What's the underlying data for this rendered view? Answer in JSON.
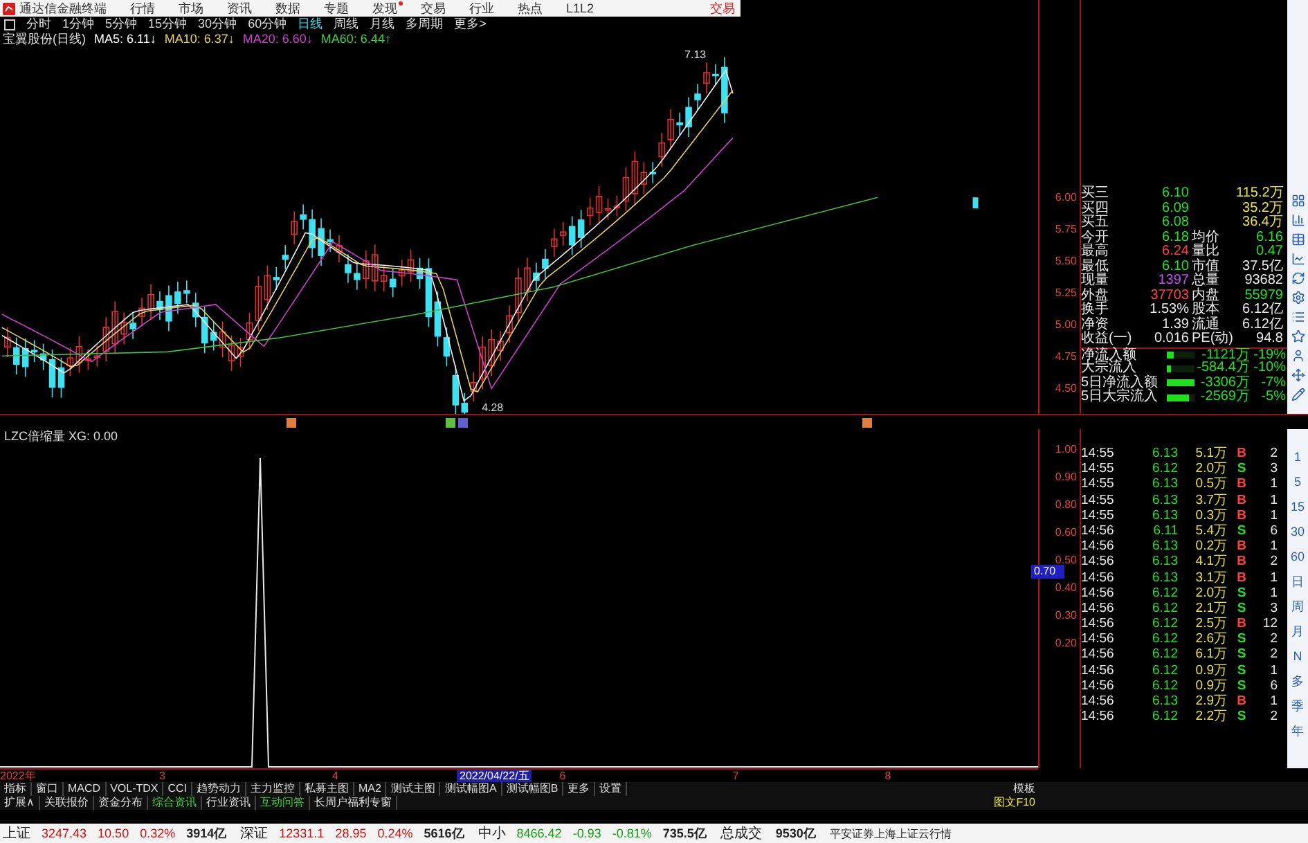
{
  "menu_bar": {
    "app_title": "通达信金融终端",
    "items": [
      "行情",
      "市场",
      "资讯",
      "数据",
      "专题",
      "发现",
      "交易",
      "行业",
      "热点",
      "L1L2"
    ],
    "trade": "交易"
  },
  "period_tabs": [
    {
      "label": "分时",
      "selected": false
    },
    {
      "label": "1分钟",
      "selected": false
    },
    {
      "label": "5分钟",
      "selected": false
    },
    {
      "label": "15分钟",
      "selected": false
    },
    {
      "label": "30分钟",
      "selected": false
    },
    {
      "label": "60分钟",
      "selected": false
    },
    {
      "label": "日线",
      "selected": true
    },
    {
      "label": "周线",
      "selected": false
    },
    {
      "label": "月线",
      "selected": false
    },
    {
      "label": "多周期",
      "selected": false
    },
    {
      "label": "更多>",
      "selected": false
    }
  ],
  "ma_legend": {
    "stock": "宝翼股份(日线)",
    "items": [
      {
        "label": "MA5: 6.11",
        "arrow": "↓",
        "color": "#ffffff"
      },
      {
        "label": "MA10: 6.37",
        "arrow": "↓",
        "color": "#e8d060"
      },
      {
        "label": "MA20: 6.60",
        "arrow": "↓",
        "color": "#d040d0"
      },
      {
        "label": "MA60: 6.44",
        "arrow": "↑",
        "color": "#40d040"
      }
    ]
  },
  "price_chart": {
    "high_label": "7.13",
    "low_label": "4.28"
  },
  "price_axis": [
    "6.00",
    "5.75",
    "5.50",
    "5.25",
    "5.00",
    "4.75",
    "4.50"
  ],
  "quote": {
    "rows": [
      {
        "left": {
          "label": "买三",
          "value": "6.10",
          "color": "#20e020"
        },
        "right": {
          "value": "115.2万",
          "color": "#e8e040"
        }
      },
      {
        "left": {
          "label": "买四",
          "value": "6.09",
          "color": "#20e020"
        },
        "right": {
          "value": "35.2万",
          "color": "#e8e040"
        }
      },
      {
        "left": {
          "label": "买五",
          "value": "6.08",
          "color": "#20e020"
        },
        "right": {
          "value": "36.4万",
          "color": "#e8e040"
        }
      },
      {
        "left": {
          "label": "今开",
          "value": "6.18",
          "color": "#20e020"
        },
        "right": {
          "label": "均价",
          "value": "6.16",
          "color": "#20e020"
        }
      },
      {
        "left": {
          "label": "最高",
          "value": "6.24",
          "color": "#ff4040"
        },
        "right": {
          "label": "量比",
          "value": "0.47",
          "color": "#20e020"
        }
      },
      {
        "left": {
          "label": "最低",
          "value": "6.10",
          "color": "#20e020"
        },
        "right": {
          "label": "市值",
          "value": "37.5亿",
          "color": "#e8e8e8"
        }
      },
      {
        "left": {
          "label": "现量",
          "value": "1397",
          "color": "#c050f0"
        },
        "right": {
          "label": "总量",
          "value": "93682",
          "color": "#e8e8e8"
        }
      },
      {
        "left": {
          "label": "外盘",
          "value": "37703",
          "color": "#ff4040"
        },
        "right": {
          "label": "内盘",
          "value": "55979",
          "color": "#20e020"
        }
      },
      {
        "left": {
          "label": "换手",
          "value": "1.53%",
          "color": "#e8e8e8"
        },
        "right": {
          "label": "股本",
          "value": "6.12亿",
          "color": "#e8e8e8"
        }
      },
      {
        "left": {
          "label": "净资",
          "value": "1.39",
          "color": "#e8e8e8"
        },
        "right": {
          "label": "流通",
          "value": "6.12亿",
          "color": "#e8e8e8"
        }
      },
      {
        "left": {
          "label": "收益(一)",
          "value": "0.016",
          "color": "#e8e8e8"
        },
        "right": {
          "label": "PE(动)",
          "value": "94.8",
          "color": "#e8e8e8"
        }
      }
    ]
  },
  "fund_flows": [
    {
      "label": "净流入额",
      "level": 0.25,
      "amount": "-1121万",
      "pct": "-19%"
    },
    {
      "label": "大宗流入",
      "level": 0.15,
      "amount": "-584.4万",
      "pct": "-10%"
    },
    {
      "label": "5日净流入额",
      "level": 1,
      "amount": "-3306万",
      "pct": "-7%"
    },
    {
      "label": "5日大宗流入",
      "level": 0.8,
      "amount": "-2569万",
      "pct": "-5%"
    }
  ],
  "indicator": {
    "legend": "LZC倍缩量 XG: 0.00",
    "ticks": [
      "1.00",
      "0.90",
      "0.80",
      "0.60",
      "0.50",
      "0.40",
      "0.30",
      "0.20"
    ],
    "cursor_value": "0.70"
  },
  "trades": [
    {
      "time": "14:55",
      "price": "6.13",
      "volume": "5.1万",
      "side": "B",
      "buy": true,
      "count": "2"
    },
    {
      "time": "14:55",
      "price": "6.12",
      "volume": "2.0万",
      "side": "S",
      "buy": false,
      "count": "3"
    },
    {
      "time": "14:55",
      "price": "6.13",
      "volume": "0.5万",
      "side": "B",
      "buy": true,
      "count": "1"
    },
    {
      "time": "14:55",
      "price": "6.13",
      "volume": "3.7万",
      "side": "B",
      "buy": true,
      "count": "1"
    },
    {
      "time": "14:55",
      "price": "6.13",
      "volume": "0.3万",
      "side": "B",
      "buy": true,
      "count": "1"
    },
    {
      "time": "14:56",
      "price": "6.11",
      "volume": "5.4万",
      "side": "S",
      "buy": false,
      "count": "6"
    },
    {
      "time": "14:56",
      "price": "6.13",
      "volume": "0.2万",
      "side": "B",
      "buy": true,
      "count": "1"
    },
    {
      "time": "14:56",
      "price": "6.13",
      "volume": "4.1万",
      "side": "B",
      "buy": true,
      "count": "2"
    },
    {
      "time": "14:56",
      "price": "6.13",
      "volume": "3.1万",
      "side": "B",
      "buy": true,
      "count": "1"
    },
    {
      "time": "14:56",
      "price": "6.12",
      "volume": "2.0万",
      "side": "S",
      "buy": false,
      "count": "1"
    },
    {
      "time": "14:56",
      "price": "6.12",
      "volume": "2.1万",
      "side": "S",
      "buy": false,
      "count": "3"
    },
    {
      "time": "14:56",
      "price": "6.12",
      "volume": "2.5万",
      "side": "B",
      "buy": true,
      "count": "12"
    },
    {
      "time": "14:56",
      "price": "6.12",
      "volume": "2.6万",
      "side": "S",
      "buy": false,
      "count": "2"
    },
    {
      "time": "14:56",
      "price": "6.12",
      "volume": "6.1万",
      "side": "S",
      "buy": false,
      "count": "2"
    },
    {
      "time": "14:56",
      "price": "6.12",
      "volume": "0.9万",
      "side": "S",
      "buy": false,
      "count": "1"
    },
    {
      "time": "14:56",
      "price": "6.12",
      "volume": "0.9万",
      "side": "S",
      "buy": false,
      "count": "6"
    },
    {
      "time": "14:56",
      "price": "6.13",
      "volume": "2.9万",
      "side": "B",
      "buy": true,
      "count": "1"
    },
    {
      "time": "14:56",
      "price": "6.12",
      "volume": "2.2万",
      "side": "S",
      "buy": false,
      "count": "2"
    }
  ],
  "side_periods": [
    "1",
    "5",
    "15",
    "30",
    "60",
    "日",
    "周",
    "月",
    "N",
    "多",
    "季",
    "年"
  ],
  "date_axis": {
    "labels": [
      "2022年",
      "3",
      "4",
      "6",
      "7",
      "8"
    ],
    "cursor_date": "2022/04/22/五"
  },
  "indicator_tabs": [
    "指标",
    "窗口",
    "MACD",
    "VOL-TDX",
    "CCI",
    "趋势动力",
    "主力监控",
    "私募主图",
    "MA2",
    "测试主图",
    "测试幅图A",
    "测试幅图B",
    "更多",
    "设置"
  ],
  "template": "模板",
  "extension_tabs": [
    {
      "label": "扩展∧",
      "selected": false
    },
    {
      "label": "关联报价",
      "selected": false
    },
    {
      "label": "资金分布",
      "selected": false
    },
    {
      "label": "综合资讯",
      "selected": true
    },
    {
      "label": "行业资讯",
      "selected": false
    },
    {
      "label": "互动问答",
      "selected": true
    },
    {
      "label": "长周户福利专窗",
      "selected": false
    }
  ],
  "f10": "图文F10",
  "status_bar": {
    "indices": [
      {
        "name": "上证",
        "value": "3247.43",
        "change": "10.50",
        "pct": "0.32%",
        "amount": "3914亿",
        "color": "#d01010"
      },
      {
        "name": "深证",
        "value": "12331.1",
        "change": "28.95",
        "pct": "0.24%",
        "amount": "5616亿",
        "color": "#d01010"
      },
      {
        "name": "中小",
        "value": "8466.42",
        "change": "-0.93",
        "pct": "-0.81%",
        "amount": "735.5亿",
        "color": "#10a010"
      }
    ],
    "total_label": "总成交",
    "total": "9530亿",
    "note": "平安证券上海上证云行情"
  }
}
